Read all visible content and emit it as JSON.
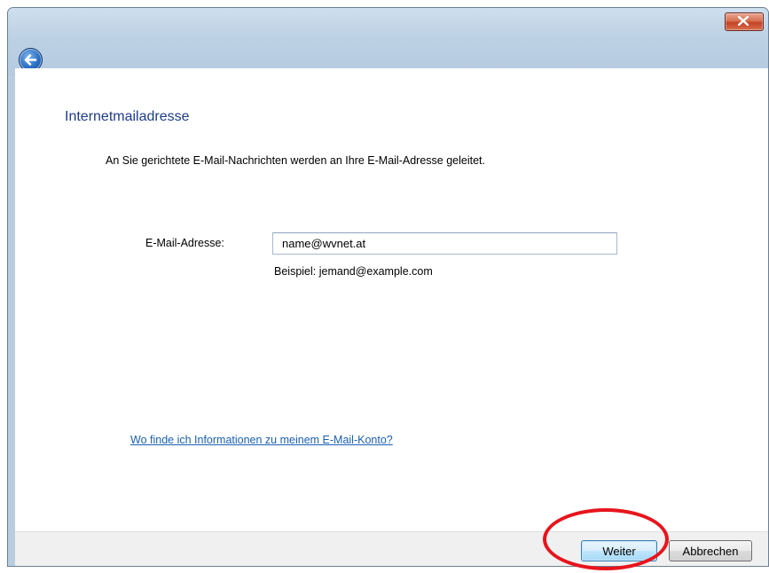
{
  "window": {
    "close_icon": "close-icon",
    "back_icon": "back-arrow-icon"
  },
  "page": {
    "title": "Internetmailadresse",
    "intro": "An Sie gerichtete E-Mail-Nachrichten werden an Ihre E-Mail-Adresse geleitet."
  },
  "email": {
    "label": "E-Mail-Adresse:",
    "value": "name@wvnet.at",
    "example": "Beispiel: jemand@example.com"
  },
  "help_link": "Wo finde ich Informationen zu meinem E-Mail-Konto?",
  "buttons": {
    "next": "Weiter",
    "cancel": "Abbrechen"
  },
  "colors": {
    "annotation_ring": "#e8141c",
    "title_blue": "#1e3c8a",
    "link_blue": "#1a5fb4"
  }
}
